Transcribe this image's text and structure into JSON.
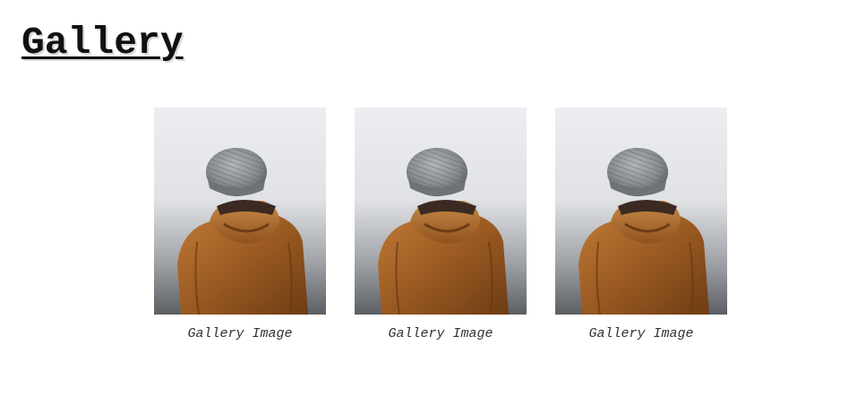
{
  "page": {
    "title": "Gallery"
  },
  "gallery": {
    "items": [
      {
        "caption": "Gallery Image",
        "image_subject": "person-in-beanie-and-brown-jacket-from-behind"
      },
      {
        "caption": "Gallery Image",
        "image_subject": "person-in-beanie-and-brown-jacket-from-behind"
      },
      {
        "caption": "Gallery Image",
        "image_subject": "person-in-beanie-and-brown-jacket-from-behind"
      }
    ]
  },
  "colors": {
    "title": "#111111",
    "caption": "#333333",
    "jacket": "#9a5a22",
    "beanie": "#8a8d92",
    "sky": "#e9eaee"
  }
}
